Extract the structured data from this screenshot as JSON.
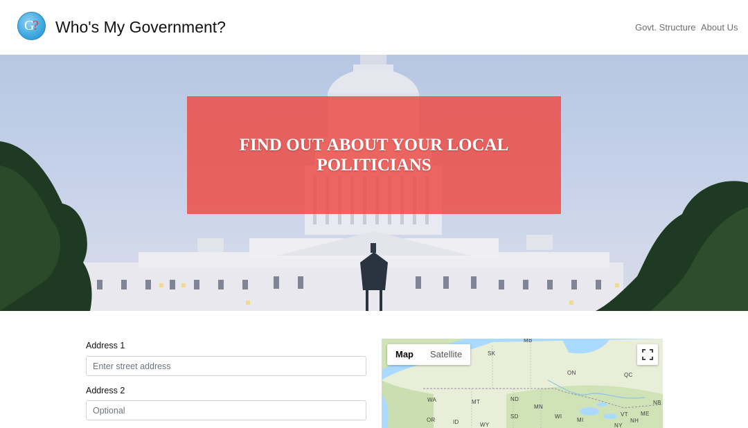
{
  "brand": {
    "logo_letters": "G",
    "logo_mark": "?",
    "title": "Who's My Government?"
  },
  "nav": {
    "govt_structure": "Govt. Structure",
    "about_us": "About Us"
  },
  "hero": {
    "headline": "FIND OUT ABOUT YOUR LOCAL POLITICIANS",
    "banner_color": "#ee4840"
  },
  "form": {
    "address1": {
      "label": "Address 1",
      "placeholder": "Enter street address",
      "value": ""
    },
    "address2": {
      "label": "Address 2",
      "placeholder": "Optional",
      "value": ""
    }
  },
  "map": {
    "type_controls": [
      "Map",
      "Satellite"
    ],
    "selected_type": "Map",
    "fullscreen_icon": "fullscreen-icon",
    "labels": [
      "MB",
      "SK",
      "ON",
      "QC",
      "WA",
      "MT",
      "ND",
      "MN",
      "NB",
      "ME",
      "OR",
      "ID",
      "WY",
      "SD",
      "WI",
      "MI",
      "NY",
      "VT",
      "NH"
    ]
  }
}
